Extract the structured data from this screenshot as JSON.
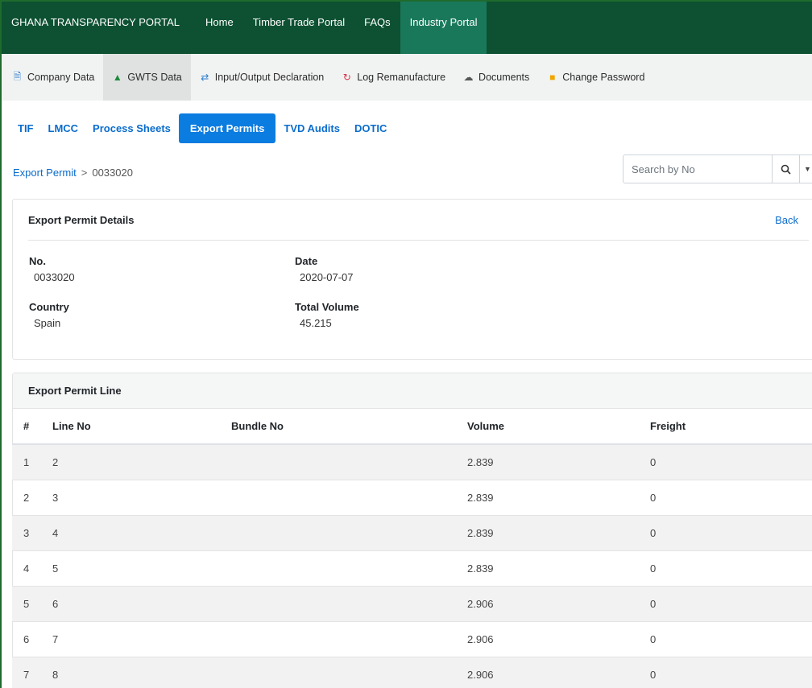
{
  "topnav": {
    "brand": "GHANA TRANSPARENCY PORTAL",
    "links": [
      "Home",
      "Timber Trade Portal",
      "FAQs",
      "Industry Portal"
    ],
    "active": "Industry Portal"
  },
  "subnav": {
    "items": [
      {
        "label": "Company Data",
        "icon": "document-icon"
      },
      {
        "label": "GWTS Data",
        "icon": "tree-icon"
      },
      {
        "label": "Input/Output Declaration",
        "icon": "exchange-icon"
      },
      {
        "label": "Log Remanufacture",
        "icon": "refresh-icon"
      },
      {
        "label": "Documents",
        "icon": "cloud-upload-icon"
      },
      {
        "label": "Change Password",
        "icon": "lock-icon"
      }
    ],
    "active": "GWTS Data"
  },
  "tabs": {
    "items": [
      "TIF",
      "LMCC",
      "Process Sheets",
      "Export Permits",
      "TVD Audits",
      "DOTIC"
    ],
    "active": "Export Permits"
  },
  "breadcrumb": {
    "parent": "Export Permit",
    "separator": ">",
    "current": "0033020"
  },
  "search": {
    "placeholder": "Search by No"
  },
  "details": {
    "title": "Export Permit Details",
    "back_label": "Back",
    "no_label": "No.",
    "no_value": "0033020",
    "date_label": "Date",
    "date_value": "2020-07-07",
    "country_label": "Country",
    "country_value": "Spain",
    "volume_label": "Total Volume",
    "volume_value": "45.215"
  },
  "lines": {
    "title": "Export Permit Line",
    "columns": [
      "#",
      "Line No",
      "Bundle No",
      "Volume",
      "Freight"
    ],
    "rows": [
      [
        "1",
        "2",
        "",
        "2.839",
        "0"
      ],
      [
        "2",
        "3",
        "",
        "2.839",
        "0"
      ],
      [
        "3",
        "4",
        "",
        "2.839",
        "0"
      ],
      [
        "4",
        "5",
        "",
        "2.839",
        "0"
      ],
      [
        "5",
        "6",
        "",
        "2.906",
        "0"
      ],
      [
        "6",
        "7",
        "",
        "2.906",
        "0"
      ],
      [
        "7",
        "8",
        "",
        "2.906",
        "0"
      ]
    ]
  },
  "colors": {
    "navbar": "#0d5132",
    "navbar_active": "#19785a",
    "link": "#0a6ccc",
    "tab_active": "#0b7ce0"
  }
}
